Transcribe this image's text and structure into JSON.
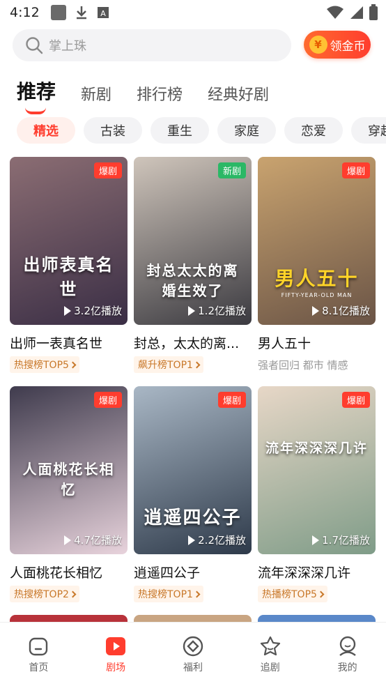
{
  "status": {
    "time": "4:12"
  },
  "search": {
    "placeholder": "掌上珠",
    "coin_label": "领金币",
    "coin_symbol": "¥"
  },
  "top_tabs": [
    {
      "label": "推荐",
      "active": true
    },
    {
      "label": "新剧"
    },
    {
      "label": "排行榜"
    },
    {
      "label": "经典好剧"
    }
  ],
  "chips": [
    "精选",
    "古装",
    "重生",
    "家庭",
    "恋爱",
    "穿越"
  ],
  "cards": [
    {
      "title": "出师一表真名世",
      "badge": "爆剧",
      "badge_type": "hot",
      "plays": "3.2亿播放",
      "tag": "热搜榜TOP5",
      "poster_text": "出师表真名世",
      "colors": [
        "#3a2e45",
        "#8b6d73"
      ]
    },
    {
      "title": "封总，太太的离...",
      "badge": "新剧",
      "badge_type": "new",
      "plays": "1.2亿播放",
      "tag": "飙升榜TOP1",
      "poster_text": "封总太太的离婚生效了",
      "colors": [
        "#3b3a40",
        "#cfc5bb"
      ]
    },
    {
      "title": "男人五十",
      "badge": "爆剧",
      "badge_type": "hot",
      "plays": "8.1亿播放",
      "meta": "强者回归 都市 情感",
      "poster_text": "男人五十",
      "poster_sub": "FIFTY-YEAR-OLD MAN",
      "colors": [
        "#6a5446",
        "#c9a36f"
      ]
    },
    {
      "title": "人面桃花长相忆",
      "badge": "爆剧",
      "badge_type": "hot",
      "plays": "4.7亿播放",
      "tag": "热搜榜TOP2",
      "poster_text": "人面桃花长相忆",
      "colors": [
        "#e8d3dc",
        "#3f3b4d"
      ]
    },
    {
      "title": "逍遥四公子",
      "badge": "爆剧",
      "badge_type": "hot",
      "plays": "2.2亿播放",
      "tag": "热搜榜TOP1",
      "poster_text": "逍遥四公子",
      "colors": [
        "#2e3a4a",
        "#a9b7c5"
      ]
    },
    {
      "title": "流年深深深几许",
      "badge": "爆剧",
      "badge_type": "hot",
      "plays": "1.7亿播放",
      "tag": "热播榜TOP5",
      "poster_text": "流年深深深几许",
      "colors": [
        "#7f9c88",
        "#e7d7c7"
      ]
    }
  ],
  "bottom_nav": [
    {
      "label": "首页",
      "icon": "home-icon"
    },
    {
      "label": "剧场",
      "icon": "theater-icon",
      "active": true
    },
    {
      "label": "福利",
      "icon": "welfare-icon"
    },
    {
      "label": "追剧",
      "icon": "follow-icon"
    },
    {
      "label": "我的",
      "icon": "profile-icon"
    }
  ],
  "accent": "#ff3d2e"
}
